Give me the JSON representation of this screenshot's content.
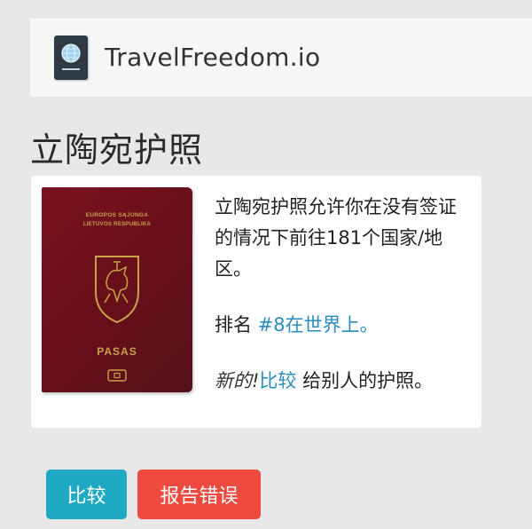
{
  "header": {
    "site_name": "TravelFreedom.io",
    "logo_icon": "passport-icon"
  },
  "page_title": "立陶宛护照",
  "passport_image": {
    "cover_line1": "EUROPOS SĄJUNGA",
    "cover_line2": "LIETUVOS RESPUBLIKA",
    "cover_word": "PASAS",
    "colors": {
      "cover": "#6a0f1a",
      "gold": "#c9a24a"
    }
  },
  "card": {
    "description": "立陶宛护照允许你在没有签证的情况下前往181个国家/地区。",
    "rank_prefix": "排名",
    "rank_link": "#8在世界上。",
    "new_tag": "新的!",
    "compare_link": "比较",
    "compare_suffix": " 给别人的护照。"
  },
  "buttons": {
    "compare_label": "比较",
    "report_label": "报告错误"
  },
  "colors": {
    "link": "#2a8bbd",
    "compare_button": "#1fa9c2",
    "report_button": "#ee4a3f"
  }
}
